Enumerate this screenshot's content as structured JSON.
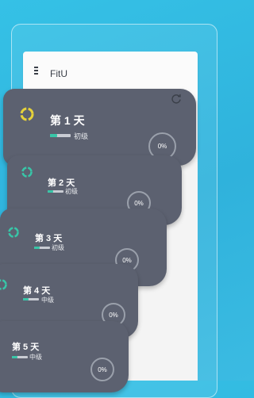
{
  "app": {
    "title": "FitU"
  },
  "colors": {
    "background": "#35c1e6",
    "card": "#5c6170",
    "progress_fill": "#38c6a8",
    "accent_ring_yellow": "#e6d23a",
    "accent_ring_teal": "#38c6a8"
  },
  "icons": {
    "menu": "menu-icon",
    "refresh": "refresh-icon"
  },
  "days": [
    {
      "label": "第 1 天",
      "level": "初级",
      "progress": "0%",
      "progress_fraction": 0,
      "ring_color": "#e6d23a"
    },
    {
      "label": "第 2 天",
      "level": "初级",
      "progress": "0%",
      "progress_fraction": 0,
      "ring_color": "#38c6a8"
    },
    {
      "label": "第 3 天",
      "level": "初级",
      "progress": "0%",
      "progress_fraction": 0,
      "ring_color": "#38c6a8"
    },
    {
      "label": "第 4 天",
      "level": "中级",
      "progress": "0%",
      "progress_fraction": 0,
      "ring_color": "#38c6a8"
    },
    {
      "label": "第 5 天",
      "level": "中级",
      "progress": "0%",
      "progress_fraction": 0,
      "ring_color": "#38c6a8"
    }
  ]
}
